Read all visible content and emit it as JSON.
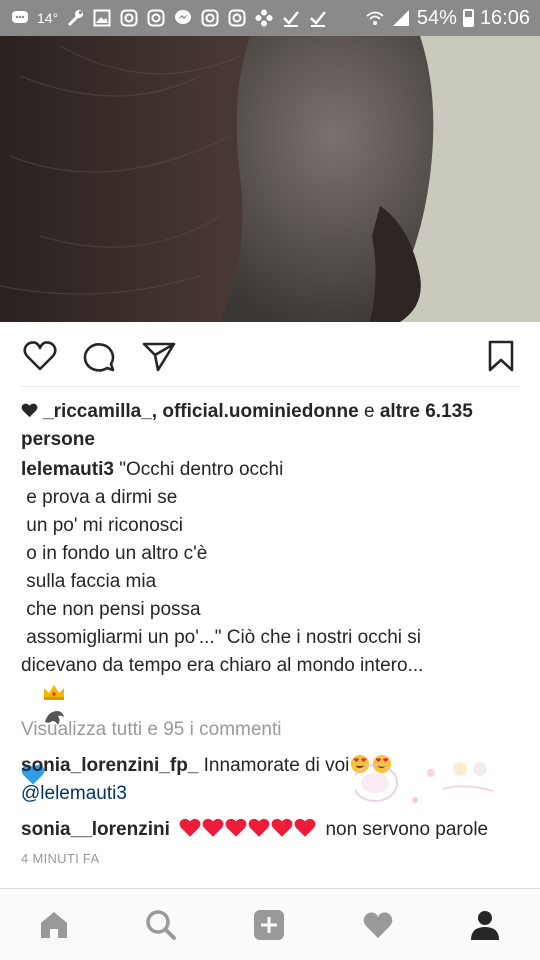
{
  "status_bar": {
    "temperature": "14°",
    "battery_percent": "54%",
    "time": "16:06",
    "icons": [
      "chat-icon",
      "wrench-icon",
      "image-icon",
      "instagram-icon",
      "instagram-icon",
      "messenger-icon",
      "instagram-icon",
      "instagram-icon",
      "flower-icon",
      "check-icon",
      "check-icon",
      "wifi-icon",
      "signal-icon",
      "battery-icon"
    ]
  },
  "actions": {
    "icons": [
      "heart-outline-icon",
      "comment-icon",
      "share-icon",
      "bookmark-icon"
    ]
  },
  "likes": {
    "users": "_riccamilla_, official.uominiedonne",
    "connector": " e ",
    "others": "altre 6.135 persone"
  },
  "caption": {
    "username": "lelemauti3",
    "lines": [
      " \"Occhi dentro occhi",
      " e prova a dirmi se",
      " un po' mi riconosci",
      " o in fondo un altro c'è",
      " sulla faccia mia",
      " che non pensi possa",
      " assomigliarmi un po'...\" Ciò che i nostri occhi si",
      "dicevano da tempo era chiaro al mondo intero..."
    ],
    "emojis": [
      "crown-icon",
      "dolphin-icon",
      "blue-heart-icon"
    ]
  },
  "view_all_comments": "Visualizza tutti e 95 i commenti",
  "comments": [
    {
      "username": "sonia_lorenzini_fp_",
      "text": " Innamorate di voi",
      "mention": "@lelemauti3"
    },
    {
      "username": "sonia__lorenzini",
      "text": "non servono parole",
      "heart_count": 6
    }
  ],
  "timestamp": "4 MINUTI FA",
  "bottom_nav": [
    "home-icon",
    "search-icon",
    "add-icon",
    "activity-icon",
    "profile-icon"
  ],
  "colors": {
    "link": "#003569",
    "muted": "#999999",
    "heart_red": "#ed1c3a",
    "status_bar": "#8a8a8a"
  }
}
